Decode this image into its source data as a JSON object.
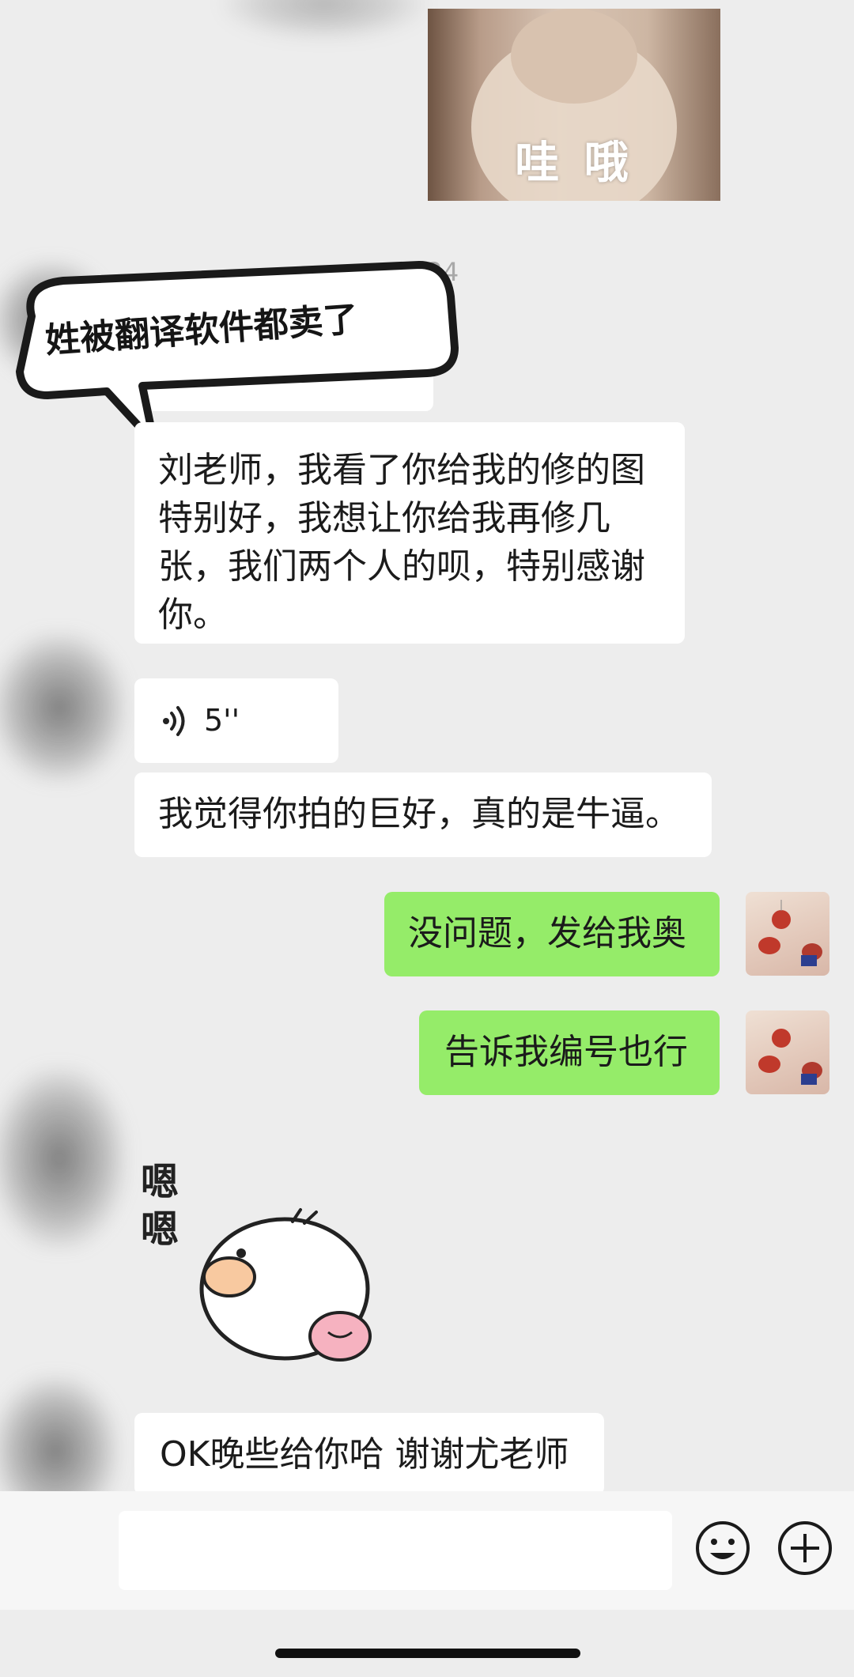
{
  "top_image": {
    "caption": "哇 哦"
  },
  "timestamp": "13:24",
  "annotation": {
    "text": "姓被翻译软件都卖了"
  },
  "messages": [
    {
      "side": "left",
      "text": "刘老师，我看了你给我的修的图特别好，我想让你给我再修几张，我们两个人的呗，特别感谢你。"
    },
    {
      "side": "left",
      "type": "voice",
      "duration": "5''"
    },
    {
      "side": "left",
      "text": "我觉得你拍的巨好，真的是牛逼。"
    },
    {
      "side": "right",
      "text": "没问题，发给我奥"
    },
    {
      "side": "right",
      "text": "告诉我编号也行"
    },
    {
      "side": "left",
      "type": "sticker",
      "sticker_text": "嗯嗯"
    },
    {
      "side": "left",
      "text": "OK晚些给你哈 谢谢尤老师"
    }
  ],
  "colors": {
    "background": "#ededed",
    "sent_bubble": "#95ec69",
    "received_bubble": "#ffffff"
  },
  "icons": {
    "voice": "voice-wave-icon",
    "emoji": "emoji-icon",
    "plus": "plus-icon"
  }
}
